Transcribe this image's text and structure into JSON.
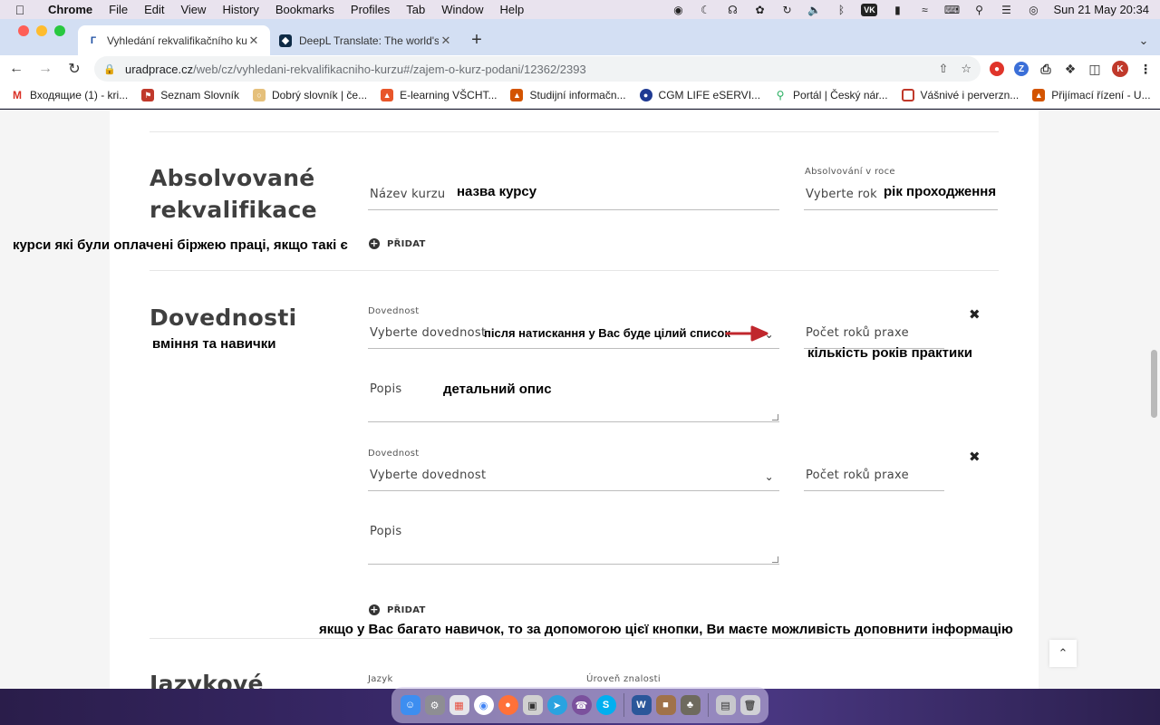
{
  "menubar": {
    "app_name": "Chrome",
    "menus": [
      "File",
      "Edit",
      "View",
      "History",
      "Bookmarks",
      "Profiles",
      "Tab",
      "Window",
      "Help"
    ],
    "tray_labels": [
      "VK"
    ],
    "clock": "Sun 21 May  20:34"
  },
  "tabs": [
    {
      "title": "Vyhledání rekvalifikačního kurzu",
      "active": true
    },
    {
      "title": "DeepL Translate: The world's most accurate translator",
      "active": false
    }
  ],
  "url": {
    "host": "uradprace.cz",
    "path": "/web/cz/vyhledani-rekvalifikacniho-kurzu#/zajem-o-kurz-podani/12362/2393"
  },
  "profile_initial": "K",
  "bookmarks": [
    "Входящие (1) - kri...",
    "Seznam Slovník",
    "Dobrý slovník | če...",
    "E-learning VŠCHT...",
    "Studijní informačn...",
    "CGM LIFE eSERVI...",
    "Portál | Český nár...",
    "Vášnivé i perverzn...",
    "Přijímací řízení - U..."
  ],
  "form": {
    "section_requal": {
      "title_line1": "Absolvované",
      "title_line2": "rekvalifikace",
      "course_name_placeholder": "Název kurzu",
      "year_label": "Absolvování v roce",
      "year_placeholder": "Vyberte rok",
      "add_label": "PŘIDAT"
    },
    "section_skills": {
      "title": "Dovednosti",
      "skill_rows": [
        {
          "skill_label": "Dovednost",
          "skill_placeholder": "Vyberte dovednost",
          "years_placeholder": "Počet roků praxe",
          "description_placeholder": "Popis"
        },
        {
          "skill_label": "Dovednost",
          "skill_placeholder": "Vyberte dovednost",
          "years_placeholder": "Počet roků praxe",
          "description_placeholder": "Popis"
        }
      ],
      "add_label": "PŘIDAT"
    },
    "section_languages": {
      "title_partial": "Jazykové",
      "language_label": "Jazyk",
      "level_label": "Úroveň znalosti"
    }
  },
  "annotations": {
    "course_name": "назва курсу",
    "year": "рік проходження",
    "requal_hint": "курси які були оплачені біржею праці, якщо такі є",
    "skills_hint": "вміння та навички",
    "skill_list_hint": "після натискання у Вас буде цілий список",
    "years_hint": "кількість років практики",
    "description_hint": "детальний опис",
    "add_hint": "якщо у Вас багато навичок, то за допомогою цієї кнопки, Ви маєте можливість доповнити інформацію"
  },
  "colors": {
    "tabstrip_bg": "#d3dff3",
    "annotation_arrow": "#c0272d",
    "section_title": "#3f3f3f"
  }
}
